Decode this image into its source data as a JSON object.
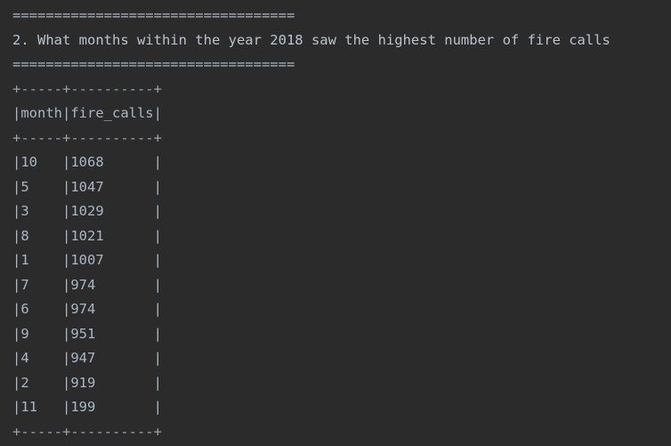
{
  "console": {
    "separator_top": "==================================",
    "question": "2. What months within the year 2018 saw the highest number of fire calls",
    "separator_bottom": "==================================",
    "table": {
      "border": "+-----+----------+",
      "header": "|month|fire_calls|",
      "rows": [
        "|10   |1068      |",
        "|5    |1047      |",
        "|3    |1029      |",
        "|8    |1021      |",
        "|1    |1007      |",
        "|7    |974       |",
        "|6    |974       |",
        "|9    |951       |",
        "|4    |947       |",
        "|2    |919       |",
        "|11   |199       |"
      ]
    }
  }
}
